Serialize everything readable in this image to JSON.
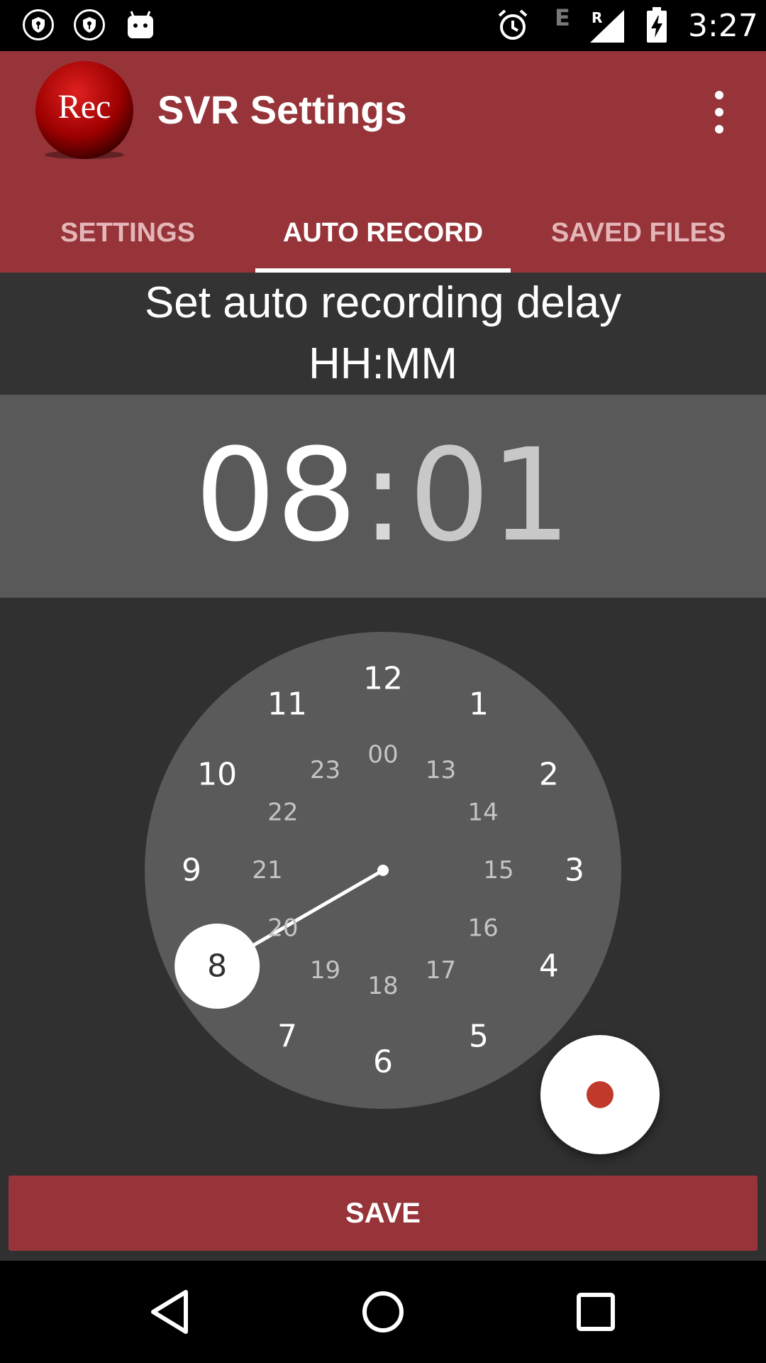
{
  "status_bar": {
    "time": "3:27",
    "network": "E",
    "roaming": "R",
    "icons": [
      "shield-icon",
      "shield-icon",
      "android-icon",
      "alarm-icon",
      "signal-icon",
      "battery-charging-icon"
    ]
  },
  "app": {
    "logo_text": "Rec",
    "title": "SVR Settings",
    "menu_icon": "more-vert-icon"
  },
  "tabs": [
    {
      "label": "SETTINGS",
      "active": false
    },
    {
      "label": "AUTO RECORD",
      "active": true
    },
    {
      "label": "SAVED FILES",
      "active": false
    }
  ],
  "auto_record": {
    "heading_line1": "Set auto recording delay",
    "heading_line2": "HH:MM",
    "hours": "08",
    "separator": ":",
    "minutes": "01",
    "selected_hour": "8",
    "outer_hours": [
      "12",
      "1",
      "2",
      "3",
      "4",
      "5",
      "6",
      "7",
      "8",
      "9",
      "10",
      "11"
    ],
    "inner_hours": [
      "00",
      "13",
      "14",
      "15",
      "16",
      "17",
      "18",
      "19",
      "20",
      "21",
      "22",
      "23"
    ]
  },
  "fab": {
    "icon": "record-dot-icon"
  },
  "save_label": "SAVE",
  "nav": {
    "icons": [
      "back-icon",
      "home-icon",
      "recents-icon"
    ]
  },
  "colors": {
    "primary": "#96343a",
    "clock_face": "#5a5a5a",
    "background": "#303030",
    "record": "#c0392b"
  }
}
